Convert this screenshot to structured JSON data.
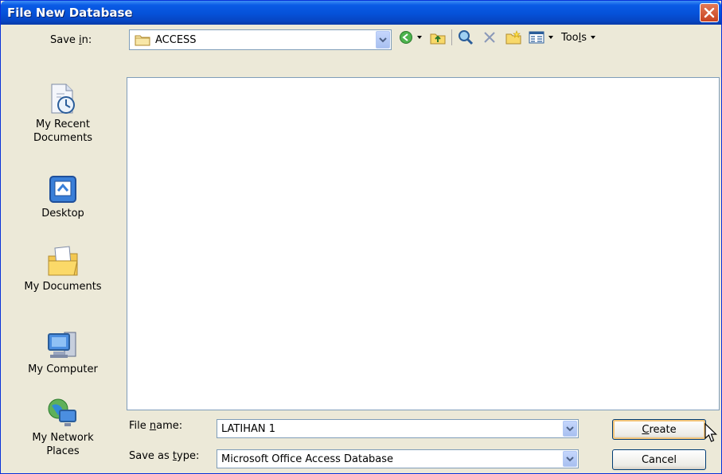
{
  "window": {
    "title": "File New Database"
  },
  "toolbar": {
    "save_in_label": "Save in:",
    "save_in_value": "ACCESS",
    "tools_label": "Tools"
  },
  "places": [
    {
      "label_line1": "My Recent",
      "label_line2": "Documents",
      "icon": "recent-documents-icon"
    },
    {
      "label_line1": "Desktop",
      "label_line2": "",
      "icon": "desktop-icon"
    },
    {
      "label_line1": "My Documents",
      "label_line2": "",
      "icon": "my-documents-icon"
    },
    {
      "label_line1": "My Computer",
      "label_line2": "",
      "icon": "my-computer-icon"
    },
    {
      "label_line1": "My Network",
      "label_line2": "Places",
      "icon": "network-places-icon"
    }
  ],
  "form": {
    "file_name_label": "File name:",
    "file_name_value": "LATIHAN 1",
    "save_type_label": "Save as type:",
    "save_type_value": "Microsoft Office Access Database"
  },
  "buttons": {
    "create": "Create",
    "cancel": "Cancel"
  },
  "colors": {
    "title_bar": "#0551d8",
    "dialog_bg": "#ece9d8",
    "close": "#c84220"
  }
}
